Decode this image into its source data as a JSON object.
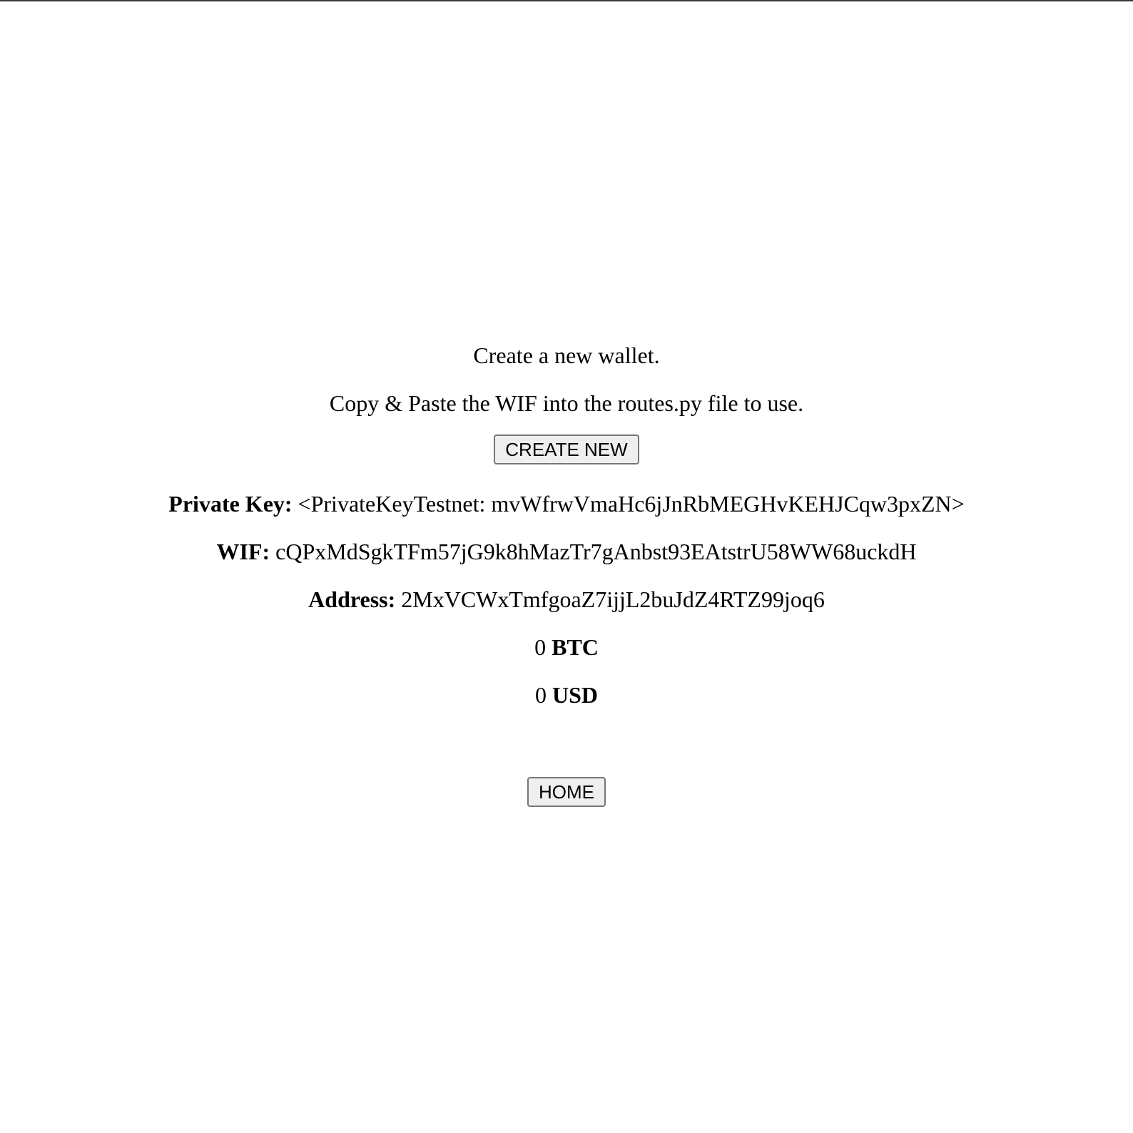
{
  "intro": {
    "heading": "Create a new wallet.",
    "instruction": "Copy & Paste the WIF into the routes.py file to use."
  },
  "buttons": {
    "create_new": "CREATE NEW",
    "home": "HOME"
  },
  "wallet": {
    "private_key_label": "Private Key:",
    "private_key_value": "<PrivateKeyTestnet: mvWfrwVmaHc6jJnRbMEGHvKEHJCqw3pxZN>",
    "wif_label": "WIF:",
    "wif_value": "cQPxMdSgkTFm57jG9k8hMazTr7gAnbst93EAtstrU58WW68uckdH",
    "address_label": "Address:",
    "address_value": "2MxVCWxTmfgoaZ7ijjL2buJdZ4RTZ99joq6"
  },
  "balances": {
    "btc_amount": "0",
    "btc_unit": "BTC",
    "usd_amount": "0",
    "usd_unit": "USD"
  }
}
